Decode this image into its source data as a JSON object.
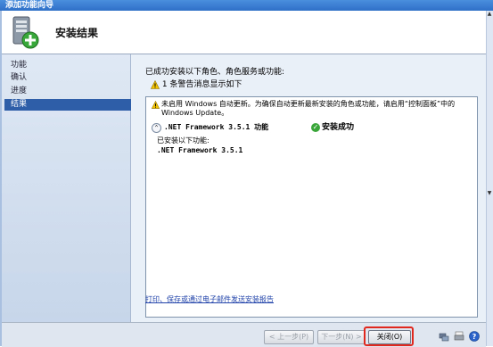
{
  "window": {
    "title": "添加功能向导"
  },
  "header": {
    "title": "安装结果",
    "icon": "server-add-icon"
  },
  "steps": [
    {
      "label": "功能",
      "active": false
    },
    {
      "label": "确认",
      "active": false
    },
    {
      "label": "进度",
      "active": false
    },
    {
      "label": "结果",
      "active": true
    }
  ],
  "content": {
    "summary": "已成功安装以下角色、角色服务或功能:",
    "warning_summary": "1 条警告消息显示如下",
    "notice": "未启用 Windows 自动更新。为确保自动更新最新安装的角色或功能，请启用“控制面板”中的 Windows Update。",
    "feature": {
      "name": ".NET Framework 3.5.1 功能",
      "status": "安装成功",
      "installed_heading": "已安装以下功能:",
      "installed_items": [
        ".NET Framework 3.5.1"
      ]
    },
    "report_link": "打印、保存或通过电子邮件发送安装报告"
  },
  "footer": {
    "prev_label": "< 上一步(P)",
    "next_label": "下一步(N) >",
    "close_label": "关闭(O)"
  },
  "colors": {
    "accent": "#2f5ea8",
    "highlight": "#e0281f",
    "success": "#3aa63a"
  }
}
